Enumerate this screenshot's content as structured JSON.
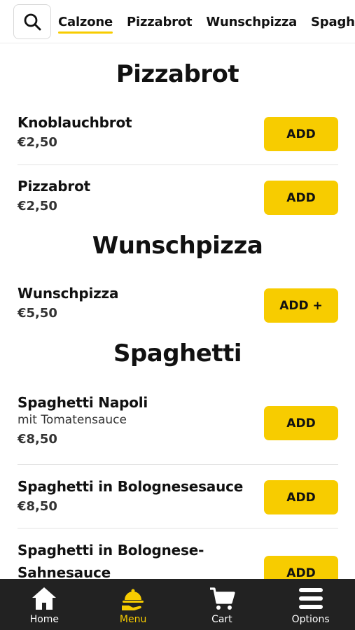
{
  "tabs": [
    {
      "label": "Calzone",
      "active": true
    },
    {
      "label": "Pizzabrot",
      "active": false
    },
    {
      "label": "Wunschpizza",
      "active": false
    },
    {
      "label": "Spaghetti",
      "active": false
    }
  ],
  "sections": {
    "pizzabrot": {
      "title": "Pizzabrot",
      "items": [
        {
          "name": "Knoblauchbrot",
          "price": "€2,50",
          "button": "ADD"
        },
        {
          "name": "Pizzabrot",
          "price": "€2,50",
          "button": "ADD"
        }
      ]
    },
    "wunschpizza": {
      "title": "Wunschpizza",
      "items": [
        {
          "name": "Wunschpizza",
          "price": "€5,50",
          "button": "ADD +"
        }
      ]
    },
    "spaghetti": {
      "title": "Spaghetti",
      "items": [
        {
          "name": "Spaghetti Napoli",
          "description": "mit Tomatensauce",
          "price": "€8,50",
          "button": "ADD"
        },
        {
          "name": "Spaghetti in Bolognesesauce",
          "price": "€8,50",
          "button": "ADD"
        },
        {
          "name_line1": "Spaghetti in Bolognese-",
          "name_line2": "Sahnesauce",
          "button": "ADD"
        }
      ]
    }
  },
  "bottom_nav": [
    {
      "label": "Home",
      "icon": "home-icon",
      "active": false
    },
    {
      "label": "Menu",
      "icon": "menu-icon",
      "active": true
    },
    {
      "label": "Cart",
      "icon": "cart-icon",
      "active": false
    },
    {
      "label": "Options",
      "icon": "options-icon",
      "active": false
    }
  ],
  "colors": {
    "accent": "#f7cc00",
    "nav_bg": "#222222"
  }
}
